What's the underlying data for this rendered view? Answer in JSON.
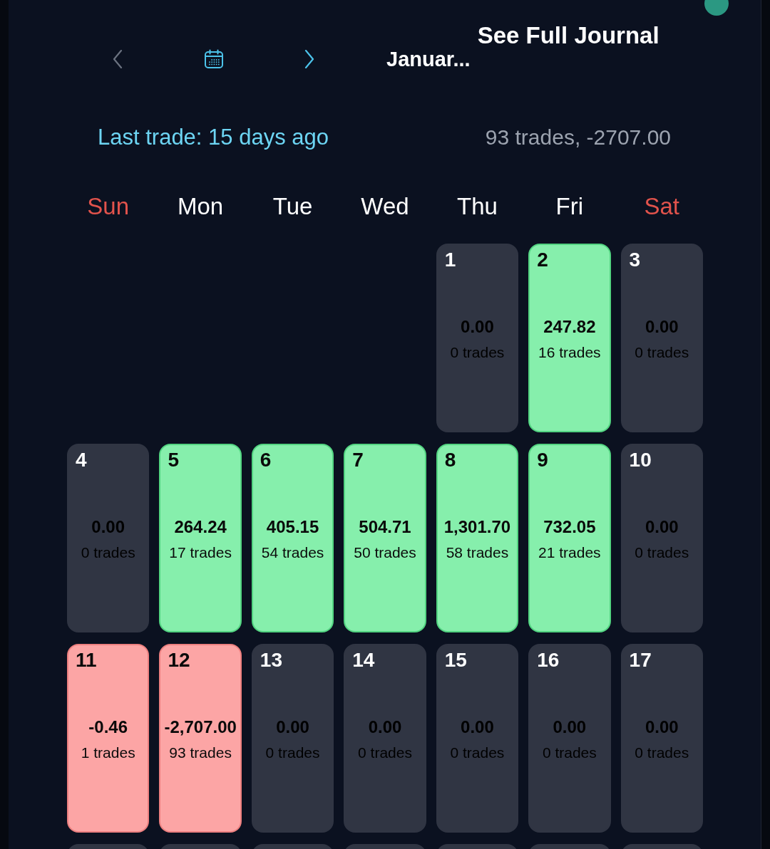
{
  "header": {
    "previous": {
      "disabled": true
    },
    "next": {
      "disabled": false
    },
    "month": "Januar...",
    "journal_link": "See Full Journal"
  },
  "summary": {
    "last_trade": "Last trade: 15 days ago",
    "totals": "93 trades, -2707.00"
  },
  "weekdays": [
    {
      "label": "Sun",
      "color": "#e2534c"
    },
    {
      "label": "Mon",
      "color": "#ffffff"
    },
    {
      "label": "Tue",
      "color": "#ffffff"
    },
    {
      "label": "Wed",
      "color": "#ffffff"
    },
    {
      "label": "Thu",
      "color": "#ffffff"
    },
    {
      "label": "Fri",
      "color": "#ffffff"
    },
    {
      "label": "Sat",
      "color": "#e2534c"
    }
  ],
  "weeks": [
    {
      "days": [
        {
          "day": "1",
          "value": "0.00",
          "trades": "0 trades",
          "kind": "flat"
        },
        {
          "day": "2",
          "value": "247.82",
          "trades": "16 trades",
          "kind": "profit"
        },
        {
          "day": "3",
          "value": "0.00",
          "trades": "0 trades",
          "kind": "flat"
        }
      ]
    },
    {
      "days": [
        {
          "day": "4",
          "value": "0.00",
          "trades": "0 trades",
          "kind": "flat"
        },
        {
          "day": "5",
          "value": "264.24",
          "trades": "17 trades",
          "kind": "profit"
        },
        {
          "day": "6",
          "value": "405.15",
          "trades": "54 trades",
          "kind": "profit"
        },
        {
          "day": "7",
          "value": "504.71",
          "trades": "50 trades",
          "kind": "profit"
        },
        {
          "day": "8",
          "value": "1,301.70",
          "trades": "58 trades",
          "kind": "profit"
        },
        {
          "day": "9",
          "value": "732.05",
          "trades": "21 trades",
          "kind": "profit"
        },
        {
          "day": "10",
          "value": "0.00",
          "trades": "0 trades",
          "kind": "flat"
        }
      ]
    },
    {
      "days": [
        {
          "day": "11",
          "value": "-0.46",
          "trades": "1 trades",
          "kind": "loss"
        },
        {
          "day": "12",
          "value": "-2,707.00",
          "trades": "93 trades",
          "kind": "loss"
        },
        {
          "day": "13",
          "value": "0.00",
          "trades": "0 trades",
          "kind": "flat"
        },
        {
          "day": "14",
          "value": "0.00",
          "trades": "0 trades",
          "kind": "flat"
        },
        {
          "day": "15",
          "value": "0.00",
          "trades": "0 trades",
          "kind": "flat"
        },
        {
          "day": "16",
          "value": "0.00",
          "trades": "0 trades",
          "kind": "flat"
        },
        {
          "day": "17",
          "value": "0.00",
          "trades": "0 trades",
          "kind": "flat"
        }
      ]
    },
    {
      "days": [
        {
          "kind": "flat"
        },
        {
          "kind": "flat"
        },
        {
          "kind": "flat"
        },
        {
          "kind": "flat"
        },
        {
          "kind": "flat"
        },
        {
          "kind": "flat"
        },
        {
          "kind": "flat"
        }
      ]
    }
  ]
}
